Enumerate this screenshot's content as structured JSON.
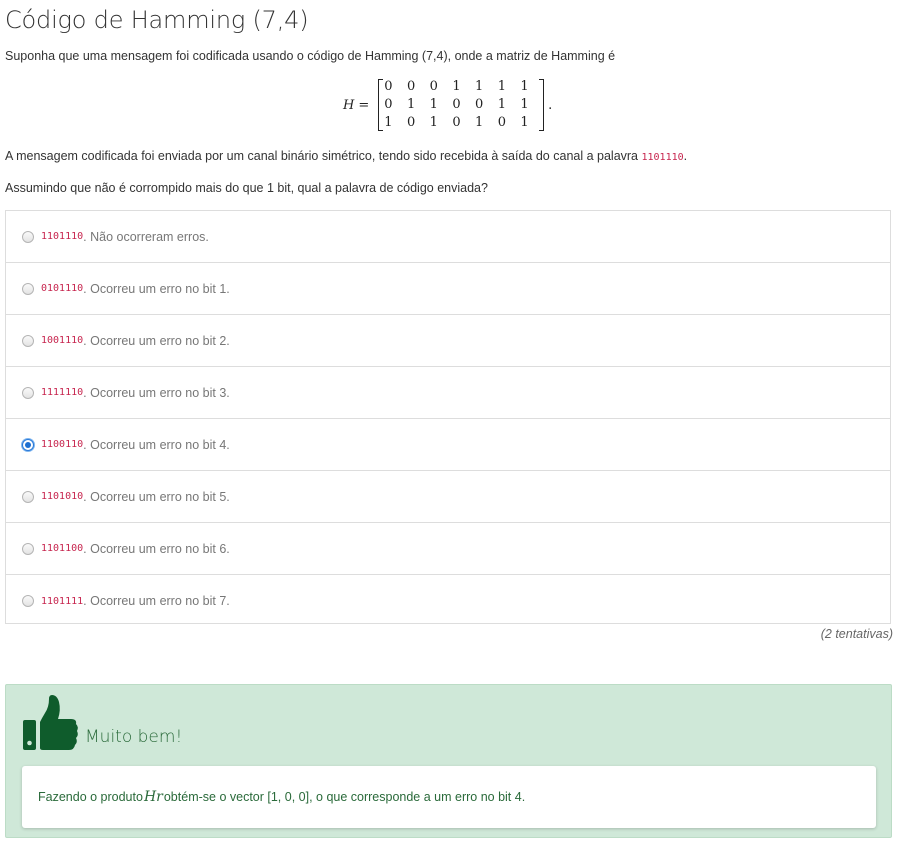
{
  "title": "Código de Hamming (7,4)",
  "intro": "Suponha que uma mensagem foi codificada usando o código de Hamming (7,4), onde a matriz de Hamming é",
  "matrix": {
    "symbol": "H",
    "equals": "=",
    "rows": [
      [
        "0",
        "0",
        "0",
        "1",
        "1",
        "1",
        "1"
      ],
      [
        "0",
        "1",
        "1",
        "0",
        "0",
        "1",
        "1"
      ],
      [
        "1",
        "0",
        "1",
        "0",
        "1",
        "0",
        "1"
      ]
    ],
    "period": "."
  },
  "channel": {
    "text_before": "A mensagem codificada foi enviada por um canal binário simétrico, tendo sido recebida à saída do canal a palavra ",
    "received_word": "1101110",
    "text_after": "."
  },
  "question": "Assumindo que não é corrompido mais do que 1 bit, qual a palavra de código enviada?",
  "options": [
    {
      "code": "1101110",
      "text": ". Não ocorreram erros.",
      "checked": false
    },
    {
      "code": "0101110",
      "text": ". Ocorreu um erro no bit 1.",
      "checked": false
    },
    {
      "code": "1001110",
      "text": ". Ocorreu um erro no bit 2.",
      "checked": false
    },
    {
      "code": "1111110",
      "text": ". Ocorreu um erro no bit 3.",
      "checked": false
    },
    {
      "code": "1100110",
      "text": ". Ocorreu um erro no bit 4.",
      "checked": true
    },
    {
      "code": "1101010",
      "text": ". Ocorreu um erro no bit 5.",
      "checked": false
    },
    {
      "code": "1101100",
      "text": ". Ocorreu um erro no bit 6.",
      "checked": false
    },
    {
      "code": "1101111",
      "text": ". Ocorreu um erro no bit 7.",
      "checked": false
    }
  ],
  "attempts": "(2 tentativas)",
  "feedback": {
    "icon": "thumbs-up-icon",
    "title": "Muito bem!",
    "text_before": "Fazendo o produto ",
    "math": "Hr",
    "text_after": " obtém-se o vector [1, 0, 0], o que corresponde a um erro no bit 4.",
    "background_color": "#cfe8d8",
    "text_color": "#2a6a3a",
    "icon_color": "#0f5c2c"
  },
  "colors": {
    "code_color": "#c7254e",
    "option_text": "#777777",
    "radio_checked": "#1e6fd0"
  }
}
